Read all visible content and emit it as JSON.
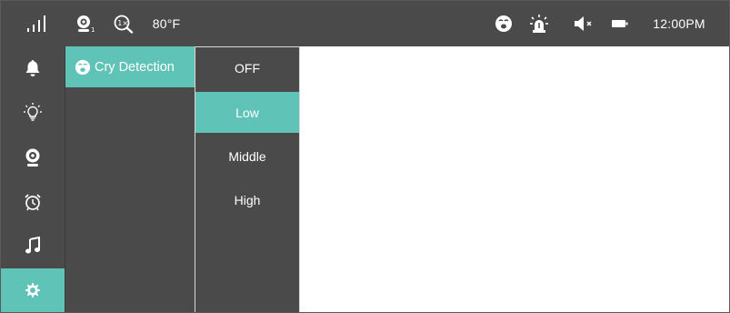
{
  "status_bar": {
    "icons": [
      "signal-icon",
      "camera-1-icon",
      "zoom-1x-icon",
      "cry-face-icon",
      "alarm-light-icon",
      "mute-icon",
      "battery-icon"
    ],
    "temperature": "80°F",
    "time": "12:00PM"
  },
  "nav": {
    "items": [
      {
        "icon": "bell-icon",
        "active": false
      },
      {
        "icon": "light-bulb-icon",
        "active": false
      },
      {
        "icon": "camera-icon",
        "active": false
      },
      {
        "icon": "alarm-clock-icon",
        "active": false
      },
      {
        "icon": "music-note-icon",
        "active": false
      },
      {
        "icon": "gear-icon",
        "active": true
      }
    ]
  },
  "settings_menu": {
    "items": [
      {
        "label": "Cry Detection",
        "icon": "cry-face-icon",
        "active": true
      }
    ]
  },
  "options": {
    "items": [
      {
        "label": "OFF",
        "selected": false
      },
      {
        "label": "Low",
        "selected": true
      },
      {
        "label": "Middle",
        "selected": false
      },
      {
        "label": "High",
        "selected": false
      }
    ]
  },
  "colors": {
    "accent": "#5fc4b7",
    "panel": "#4a4a4a",
    "background": "#ffffff"
  }
}
